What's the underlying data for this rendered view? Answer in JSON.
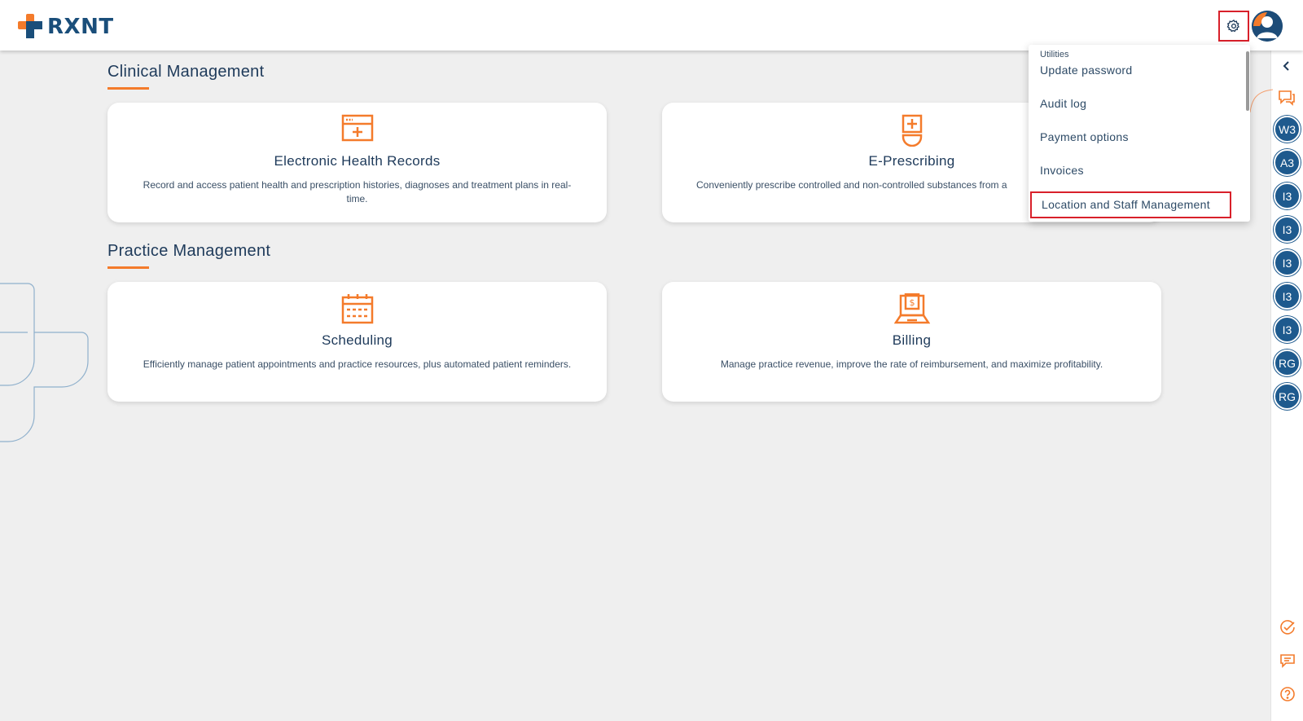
{
  "header": {
    "logo_text": "RXNT"
  },
  "sections": [
    {
      "title": "Clinical Management"
    },
    {
      "title": "Practice Management"
    }
  ],
  "cards": [
    {
      "title": "Electronic Health Records",
      "desc": "Record and access patient health and prescription histories, diagnoses and treatment plans in real-time.",
      "icon": "ehr-icon"
    },
    {
      "title": "E-Prescribing",
      "desc": "Conveniently prescribe controlled and non-controlled substances from a",
      "icon": "eprescribe-icon"
    },
    {
      "title": "Scheduling",
      "desc": "Efficiently manage patient appointments and practice resources, plus automated patient reminders.",
      "icon": "calendar-icon"
    },
    {
      "title": "Billing",
      "desc": "Manage practice revenue, improve the rate of reimbursement, and maximize profitability.",
      "icon": "billing-icon"
    }
  ],
  "dropdown": {
    "header": "Utilities",
    "items": [
      "Update password",
      "Audit log",
      "Payment options",
      "Invoices",
      "Location and Staff Management"
    ]
  },
  "rail": {
    "badges": [
      "W3",
      "A3",
      "I3",
      "I3",
      "I3",
      "I3",
      "I3",
      "RG",
      "RG"
    ],
    "icons": [
      "chevron-left-icon",
      "chat-bubbles-icon",
      "check-circle-icon",
      "message-icon",
      "help-icon"
    ]
  },
  "colors": {
    "accent": "#f47b2b",
    "navy": "#1e3a5a",
    "badge": "#1e5a8e",
    "highlight": "#d8202a"
  }
}
